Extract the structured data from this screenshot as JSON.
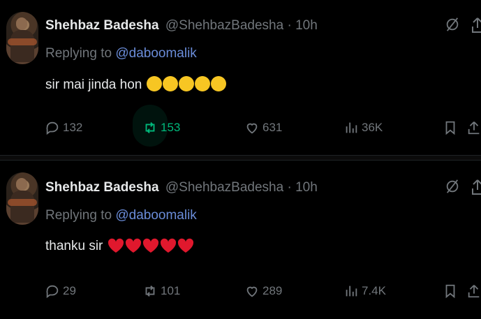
{
  "tweets": [
    {
      "name": "Shehbaz Badesha",
      "handle": "@ShehbazBadesha",
      "sep": " · ",
      "time": "10h",
      "replying_prefix": "Replying to ",
      "replying_to": "@daboomalik",
      "text": "sir mai jinda hon",
      "emoji_count": 5,
      "replies": "132",
      "reposts": "153",
      "likes": "631",
      "views": "36K",
      "repost_active": true
    },
    {
      "name": "Shehbaz Badesha",
      "handle": "@ShehbazBadesha",
      "sep": " · ",
      "time": "10h",
      "replying_prefix": "Replying to ",
      "replying_to": "@daboomalik",
      "text": "thanku sir",
      "hearts": 5,
      "replies": "29",
      "reposts": "101",
      "likes": "289",
      "views": "7.4K",
      "repost_active": false
    }
  ],
  "colors": {
    "background": "#000000",
    "text": "#e7e9ea",
    "muted": "#71767b",
    "mention": "#6a8cd8",
    "repost_active": "#00ba7c",
    "heart": "#e0182d"
  },
  "icons": [
    "grok-icon",
    "share-icon",
    "reply-icon",
    "repost-icon",
    "like-icon",
    "views-icon",
    "bookmark-icon"
  ]
}
